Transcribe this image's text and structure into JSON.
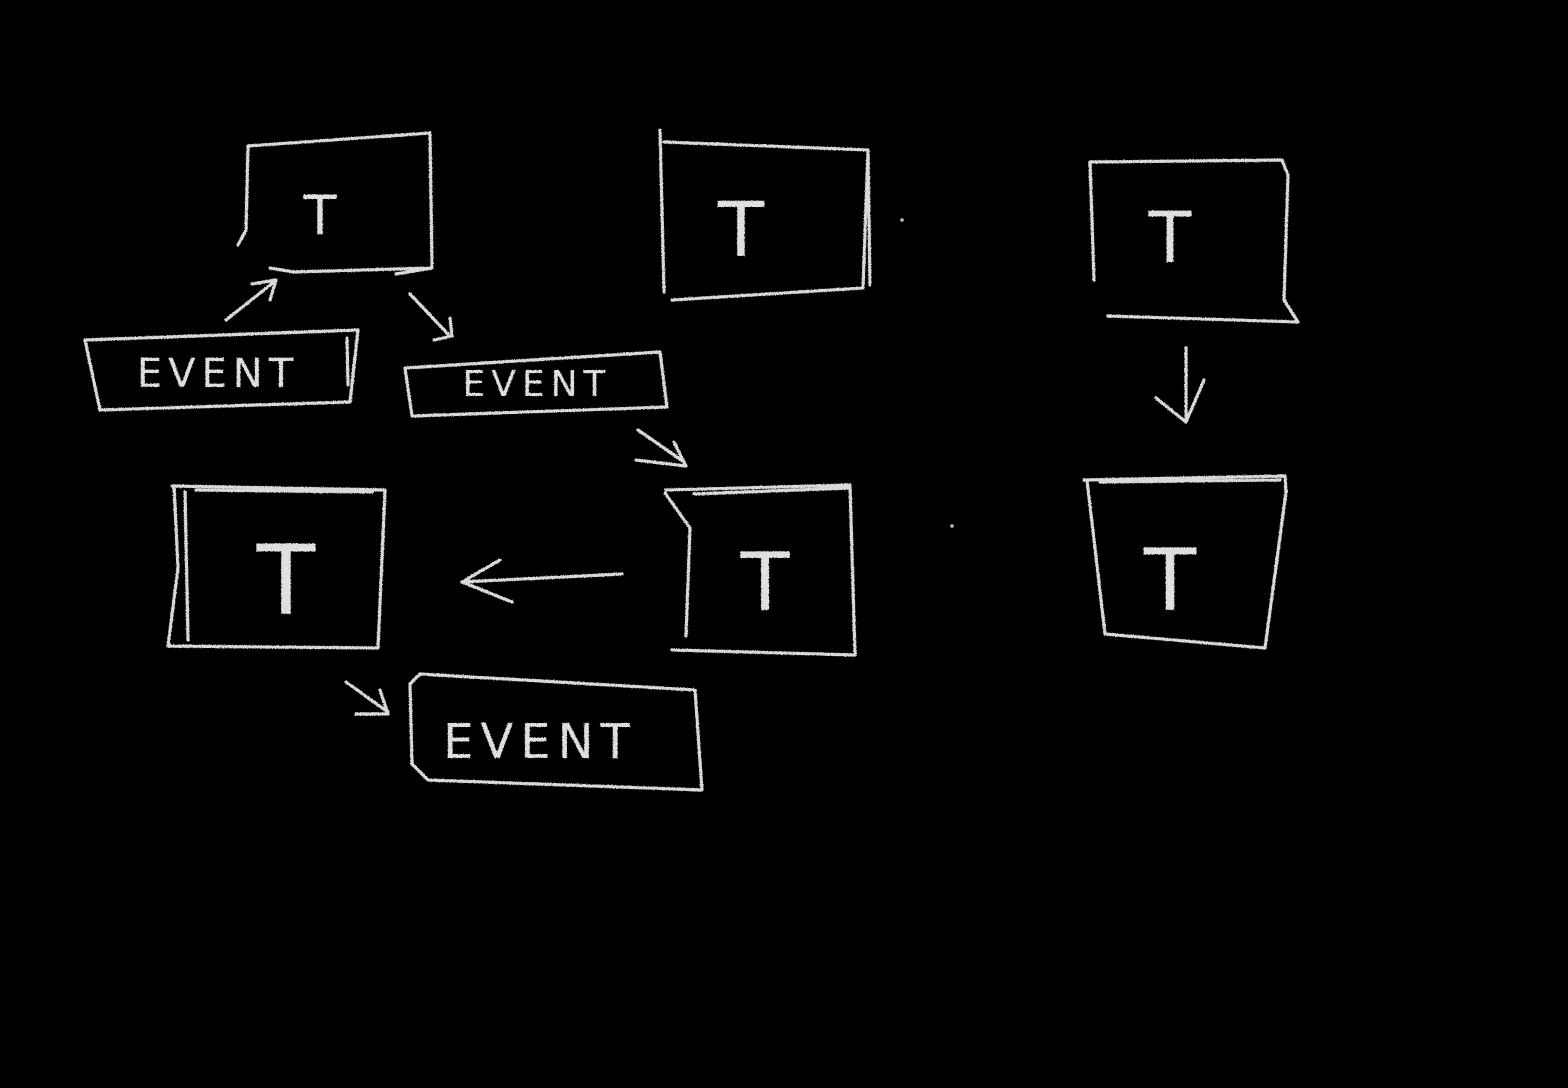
{
  "diagram": {
    "background": "#000000",
    "chalk_color": "#dcdcdc",
    "nodes": [
      {
        "id": "t1",
        "kind": "T",
        "label": "T"
      },
      {
        "id": "t2",
        "kind": "T",
        "label": "T"
      },
      {
        "id": "t3",
        "kind": "T",
        "label": "T"
      },
      {
        "id": "t4",
        "kind": "T",
        "label": "T"
      },
      {
        "id": "t5",
        "kind": "T",
        "label": "T"
      },
      {
        "id": "t6",
        "kind": "T",
        "label": "T"
      },
      {
        "id": "e1",
        "kind": "EVENT",
        "label": "EVENT"
      },
      {
        "id": "e2",
        "kind": "EVENT",
        "label": "EVENT"
      },
      {
        "id": "e3",
        "kind": "EVENT",
        "label": "EVENT"
      }
    ],
    "edges": [
      {
        "from": "e1",
        "to": "t1"
      },
      {
        "from": "t1",
        "to": "e2"
      },
      {
        "from": "e2",
        "to": "t5"
      },
      {
        "from": "t5",
        "to": "t4"
      },
      {
        "from": "t4",
        "to": "e3"
      },
      {
        "from": "t3",
        "to": "t6"
      }
    ]
  }
}
